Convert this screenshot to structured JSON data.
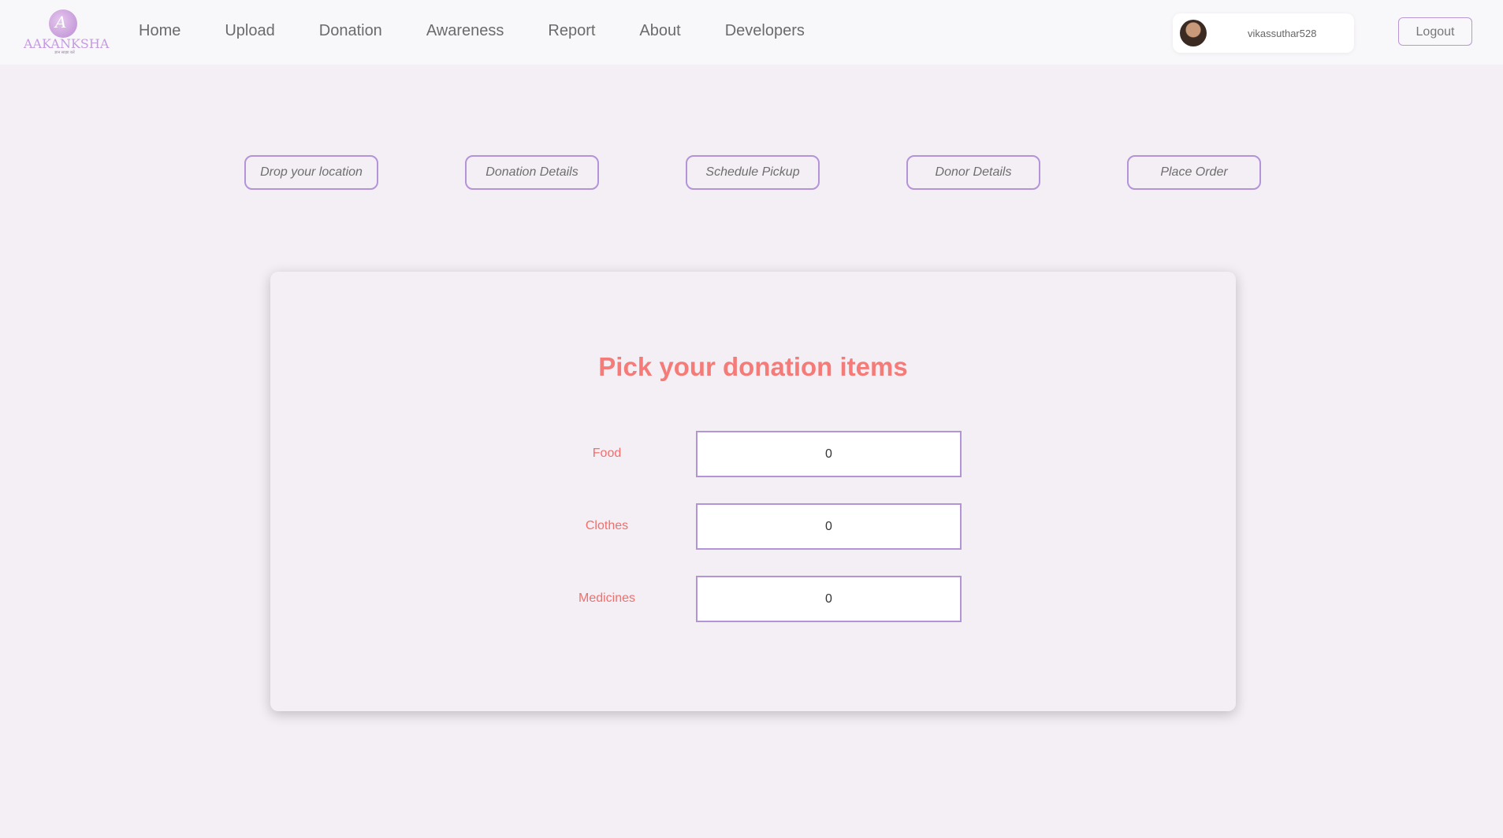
{
  "brand": {
    "name": "AAKANKSHA",
    "tagline": "ज्ञान साझा करें"
  },
  "nav": {
    "items": [
      "Home",
      "Upload",
      "Donation",
      "Awareness",
      "Report",
      "About",
      "Developers"
    ]
  },
  "user": {
    "username": "vikassuthar528",
    "logout_label": "Logout"
  },
  "steps": [
    "Drop your location",
    "Donation Details",
    "Schedule Pickup",
    "Donor Details",
    "Place Order"
  ],
  "form": {
    "title": "Pick your donation items",
    "fields": [
      {
        "label": "Food",
        "value": "0"
      },
      {
        "label": "Clothes",
        "value": "0"
      },
      {
        "label": "Medicines",
        "value": "0"
      }
    ]
  },
  "colors": {
    "accent_purple": "#b394d6",
    "title_coral": "#f47b78",
    "page_bg": "#f3eff5"
  }
}
